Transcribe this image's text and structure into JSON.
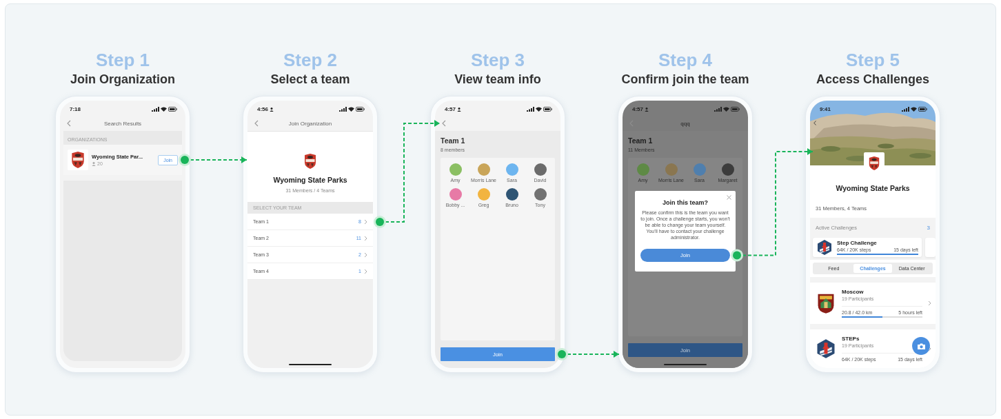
{
  "steps": [
    {
      "label": "Step 1",
      "title": "Join Organization",
      "screen": {
        "kind": "search",
        "time": "7:18",
        "nav_title": "Search Results",
        "section": "ORGANIZATIONS",
        "result": {
          "name": "Wyoming State Par...",
          "members": "20",
          "button": "Join"
        }
      }
    },
    {
      "label": "Step 2",
      "title": "Select a team",
      "screen": {
        "kind": "org",
        "time": "4:56",
        "nav_title": "Join Organization",
        "org_name": "Wyoming State Parks",
        "org_meta": "31 Members / 4 Teams",
        "section": "SELECT YOUR TEAM",
        "home_indicator": true,
        "teams": [
          {
            "name": "Team 1",
            "count": "8"
          },
          {
            "name": "Team 2",
            "count": "11"
          },
          {
            "name": "Team 3",
            "count": "2"
          },
          {
            "name": "Team 4",
            "count": "1"
          }
        ]
      }
    },
    {
      "label": "Step 3",
      "title": "View team info",
      "screen": {
        "kind": "team",
        "time": "4:57",
        "team_name": "Team 1",
        "team_meta": "8 members",
        "button": "Join",
        "members": [
          {
            "name": "Amy",
            "color": "#8bbf63"
          },
          {
            "name": "Morris Lane",
            "color": "#c9a559"
          },
          {
            "name": "Sara",
            "color": "#6db5ef"
          },
          {
            "name": "David",
            "color": "#6b6b6b"
          },
          {
            "name": "Bobby ...",
            "color": "#e77aa6"
          },
          {
            "name": "Greg",
            "color": "#f2b440"
          },
          {
            "name": "Bruno",
            "color": "#2f5574"
          },
          {
            "name": "Tony",
            "color": "#727272"
          }
        ]
      }
    },
    {
      "label": "Step 4",
      "title": "Confirm join the team",
      "screen": {
        "kind": "confirm",
        "time": "4:57",
        "nav_title": "qqq",
        "team_name": "Team 1",
        "team_meta": "11 Members",
        "button": "Join",
        "home_indicator": true,
        "members": [
          {
            "name": "Amy",
            "color": "#5e8a45"
          },
          {
            "name": "Morris Lane",
            "color": "#8a7650"
          },
          {
            "name": "Sara",
            "color": "#4f7fae"
          },
          {
            "name": "Margaret",
            "color": "#3c3c3c"
          }
        ],
        "dialog": {
          "title": "Join this team?",
          "message": "Please confirm this is the team you want to join. Once a challenge starts, you won't be able to change your team yourself. You'll have to contact your challenge administrator.",
          "button": "Join"
        }
      }
    },
    {
      "label": "Step 5",
      "title": "Access Challenges",
      "screen": {
        "kind": "challenges",
        "time": "9:41",
        "org_name": "Wyoming State Parks",
        "org_meta": "31 Members, 4 Teams",
        "active_label": "Active Challenges",
        "active_count": "3",
        "featured": {
          "name": "Step Challenge",
          "progress": "64K / 20K steps",
          "remaining": "15 days left",
          "level": 1
        },
        "tabs": [
          {
            "label": "Feed",
            "selected": false
          },
          {
            "label": "Challenges",
            "selected": true
          },
          {
            "label": "Data Center",
            "selected": false
          }
        ],
        "challenges": [
          {
            "kind": "shield",
            "name": "Moscow",
            "participants": "19 Participants",
            "progress": "20.8 / 42.0 km",
            "remaining": "5 hours left",
            "level": 0.5
          },
          {
            "kind": "hexagon",
            "name": "STEPs",
            "participants": "19 Participants",
            "progress": "64K / 20K steps",
            "remaining": "15 days left"
          }
        ]
      }
    }
  ]
}
